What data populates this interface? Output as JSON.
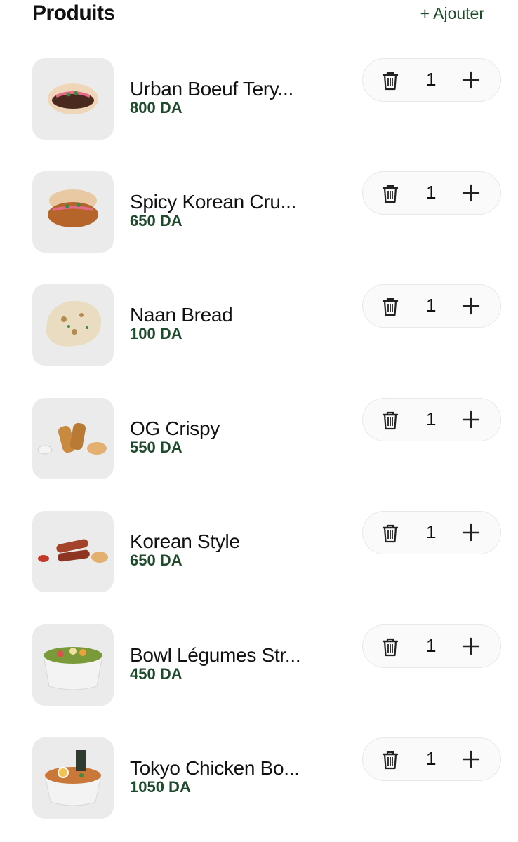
{
  "header": {
    "title": "Produits",
    "add_label": "+ Ajouter"
  },
  "products": [
    {
      "name": "Urban Boeuf Tery...",
      "price": "800 DA",
      "qty": "1",
      "image": "burger-bun"
    },
    {
      "name": "Spicy Korean Cru...",
      "price": "650 DA",
      "qty": "1",
      "image": "crispy-chicken-bun"
    },
    {
      "name": "Naan Bread",
      "price": "100 DA",
      "qty": "1",
      "image": "naan"
    },
    {
      "name": "OG Crispy",
      "price": "550 DA",
      "qty": "1",
      "image": "chicken-tenders"
    },
    {
      "name": "Korean Style",
      "price": "650 DA",
      "qty": "1",
      "image": "korean-tenders"
    },
    {
      "name": "Bowl Légumes Str...",
      "price": "450 DA",
      "qty": "1",
      "image": "veggie-bowl"
    },
    {
      "name": "Tokyo Chicken Bo...",
      "price": "1050 DA",
      "qty": "1",
      "image": "ramen-bowl"
    }
  ],
  "icons": {
    "delete": "trash-icon",
    "increment": "plus-icon"
  },
  "colors": {
    "accent_green": "#1f4a2c",
    "thumb_bg": "#ebebeb",
    "stepper_bg": "#fafafa"
  }
}
